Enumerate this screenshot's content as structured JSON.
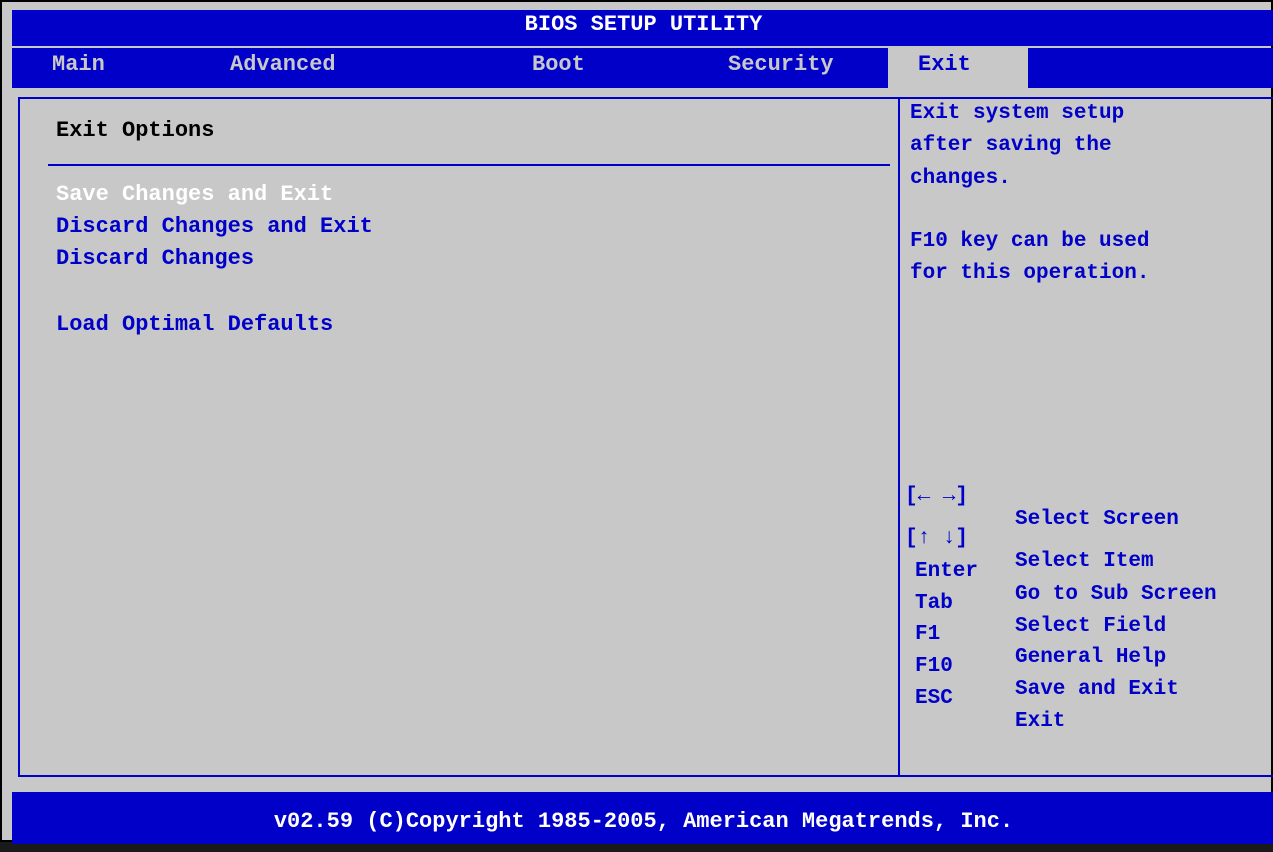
{
  "title": "BIOS SETUP UTILITY",
  "tabs": [
    {
      "label": "Main"
    },
    {
      "label": "Advanced"
    },
    {
      "label": "Boot"
    },
    {
      "label": "Security"
    },
    {
      "label": "Exit"
    }
  ],
  "active_tab": "Exit",
  "section_title": "Exit Options",
  "menu": [
    {
      "label": "Save Changes and Exit",
      "selected": true
    },
    {
      "label": "Discard Changes and Exit",
      "selected": false
    },
    {
      "label": "Discard Changes",
      "selected": false
    },
    {
      "label": "Load Optimal Defaults",
      "selected": false
    }
  ],
  "help_text": [
    "Exit system setup",
    "after saving the",
    "changes.",
    "",
    "F10 key can be used",
    "for this operation."
  ],
  "key_legend": [
    {
      "key": "[← →]",
      "desc": "Select Screen"
    },
    {
      "key": "[↑ ↓]",
      "desc": "Select Item"
    },
    {
      "key": "Enter",
      "desc": "Go to Sub Screen"
    },
    {
      "key": "Tab",
      "desc": "Select Field"
    },
    {
      "key": "F1",
      "desc": "General Help"
    },
    {
      "key": "F10",
      "desc": "Save and Exit"
    },
    {
      "key": "ESC",
      "desc": "Exit"
    }
  ],
  "footer": "v02.59 (C)Copyright 1985-2005, American Megatrends, Inc.",
  "colors": {
    "background": "#c8c8c8",
    "accent_blue": "#0000c8",
    "highlight_text": "#ffffff"
  }
}
